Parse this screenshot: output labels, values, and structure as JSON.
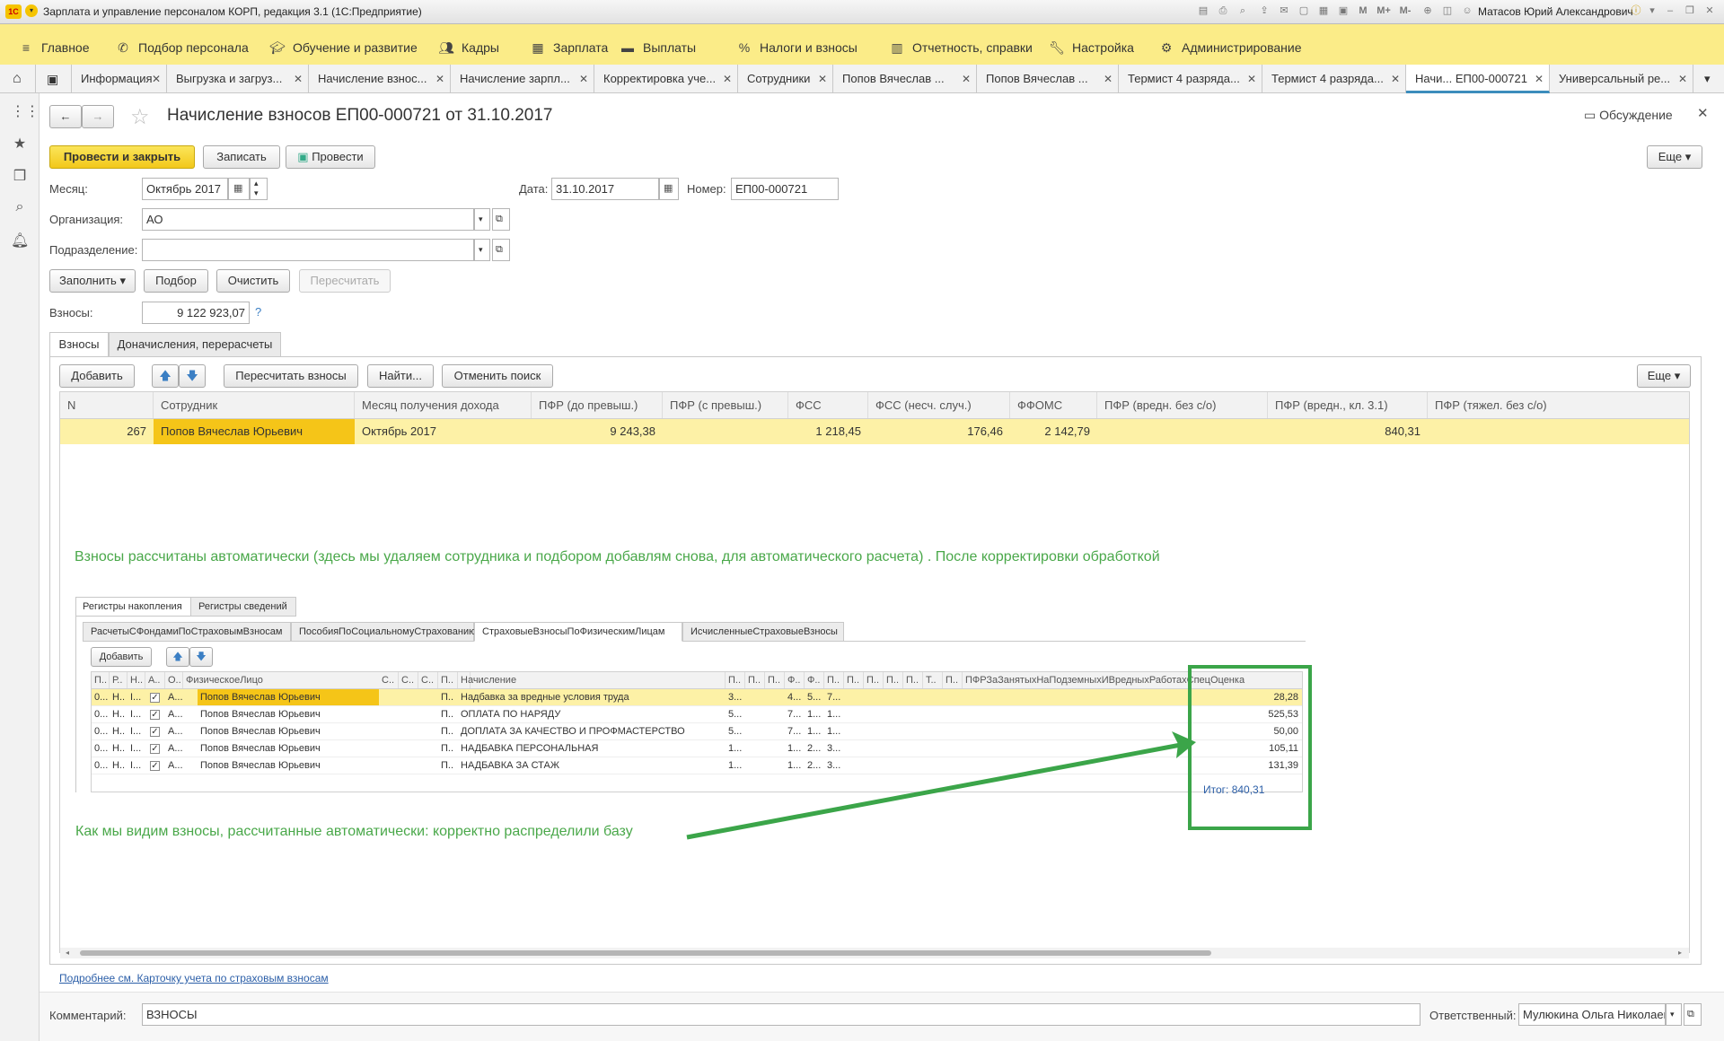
{
  "window": {
    "title": "Зарплата и управление персоналом КОРП, редакция 3.1  (1С:Предприятие)",
    "user": "Матасов Юрий Александрович"
  },
  "menu": [
    "Главное",
    "Подбор персонала",
    "Обучение и развитие",
    "Кадры",
    "Зарплата",
    "Выплаты",
    "Налоги и взносы",
    "Отчетность, справки",
    "Настройка",
    "Администрирование"
  ],
  "tabs": [
    "Информация",
    "Выгрузка и загруз...",
    "Начисление взнос...",
    "Начисление зарпл...",
    "Корректировка уче...",
    "Сотрудники",
    "Попов Вячеслав ...",
    "Попов Вячеслав ...",
    "Термист 4 разряда...",
    "Термист 4 разряда...",
    "Начи... ЕП00-000721",
    "Универсальный ре..."
  ],
  "doc": {
    "title": "Начисление взносов ЕП00-000721 от 31.10.2017",
    "discussion": "Обсуждение",
    "btn_post_close": "Провести и закрыть",
    "btn_save": "Записать",
    "btn_post": "Провести",
    "btn_more": "Еще",
    "month_label": "Месяц:",
    "month_value": "Октябрь 2017",
    "date_label": "Дата:",
    "date_value": "31.10.2017",
    "number_label": "Номер:",
    "number_value": "ЕП00-000721",
    "org_label": "Организация:",
    "org_value": "АО",
    "dept_label": "Подразделение:",
    "dept_value": "",
    "btn_fill": "Заполнить",
    "btn_select": "Подбор",
    "btn_clear": "Очистить",
    "btn_recalc": "Пересчитать",
    "contrib_label": "Взносы:",
    "contrib_value": "9 122 923,07",
    "help": "?",
    "tab1": "Взносы",
    "tab2": "Доначисления, перерасчеты",
    "btn_add": "Добавить",
    "btn_recalc_contrib": "Пересчитать взносы",
    "btn_find": "Найти...",
    "btn_cancel_search": "Отменить поиск",
    "link": "Подробнее см. Карточку учета по страховым взносам",
    "comment_label": "Комментарий:",
    "comment_value": "ВЗНОСЫ",
    "resp_label": "Ответственный:",
    "resp_value": "Мулюкина Ольга Николаевна"
  },
  "grid": {
    "columns": [
      "N",
      "Сотрудник",
      "Месяц получения дохода",
      "ПФР (до превыш.)",
      "ПФР (с превыш.)",
      "ФСС",
      "ФСС (несч. случ.)",
      "ФФОМС",
      "ПФР (вредн. без с/о)",
      "ПФР (вредн., кл. 3.1)",
      "ПФР (тяжел. без с/о)"
    ],
    "row": [
      "267",
      "Попов Вячеслав Юрьевич",
      "Октябрь 2017",
      "9 243,38",
      "",
      "1 218,45",
      "176,46",
      "2 142,79",
      "",
      "840,31",
      ""
    ]
  },
  "annotation1": "Взносы рассчитаны автоматически (здесь мы удаляем сотрудника и подбором добавлям снова, для автоматического расчета)  . После корректировки обработкой",
  "annotation2": "Как мы видим взносы, рассчитанные автоматически: корректно распределили базу",
  "sub": {
    "tabs_top": [
      "Регистры накопления",
      "Регистры сведений"
    ],
    "tabs_second": [
      "РасчетыСФондамиПоСтраховымВзносам",
      "ПособияПоСоциальномуСтрахованию",
      "СтраховыеВзносыПоФизическимЛицам",
      "ИсчисленныеСтраховыеВзносы"
    ],
    "btn_add": "Добавить",
    "headers": [
      "П..",
      "Р..",
      "Н..",
      "А..",
      "О..",
      "ФизическоеЛицо",
      "С..",
      "С..",
      "С..",
      "П..",
      "Начисление",
      "П..",
      "П..",
      "П..",
      "Ф..",
      "Ф..",
      "П..",
      "П..",
      "П..",
      "П..",
      "П..",
      "Т..",
      "П..",
      "ПФРЗаЗанятыхНаПодземныхИВредныхРаботахСпецОценка"
    ],
    "rows": [
      {
        "c1": "0...",
        "c2": "Н..",
        "c3": "I...",
        "c5": "А...",
        "person": "Попов Вячеслав Юрьевич",
        "c9": "П..",
        "c10": "Р...",
        "accrual": "Надбавка за вредные условия труда",
        "n1": "3...",
        "n2": "4...",
        "n3": "5...",
        "n4": "7...",
        "value": "28,28"
      },
      {
        "c1": "0...",
        "c2": "Н..",
        "c3": "I...",
        "c5": "А...",
        "person": "Попов Вячеслав Юрьевич",
        "c9": "П..",
        "c10": "Р...",
        "accrual": "ОПЛАТА ПО НАРЯДУ",
        "n1": "5...",
        "n2": "7...",
        "n3": "1...",
        "n4": "1...",
        "value": "525,53"
      },
      {
        "c1": "0...",
        "c2": "Н..",
        "c3": "I...",
        "c5": "А...",
        "person": "Попов Вячеслав Юрьевич",
        "c9": "П..",
        "c10": "Р...",
        "accrual": "ДОПЛАТА ЗА КАЧЕСТВО И ПРОФМАСТЕРСТВО",
        "n1": "5...",
        "n2": "7...",
        "n3": "1...",
        "n4": "1...",
        "value": "50,00"
      },
      {
        "c1": "0...",
        "c2": "Н..",
        "c3": "I...",
        "c5": "А...",
        "person": "Попов Вячеслав Юрьевич",
        "c9": "П..",
        "c10": "Р...",
        "accrual": "НАДБАВКА ПЕРСОНАЛЬНАЯ",
        "n1": "1...",
        "n2": "1...",
        "n3": "2...",
        "n4": "3...",
        "value": "105,11"
      },
      {
        "c1": "0...",
        "c2": "Н..",
        "c3": "I...",
        "c5": "А...",
        "person": "Попов Вячеслав Юрьевич",
        "c9": "П..",
        "c10": "Р...",
        "accrual": "НАДБАВКА ЗА СТАЖ",
        "n1": "1...",
        "n2": "1...",
        "n3": "2...",
        "n4": "3...",
        "value": "131,39"
      }
    ],
    "total": "Итог: 840,31"
  },
  "colors": {
    "accent": "#f2c81a",
    "menu_bg": "#fbec88",
    "selected_row": "#fdf1a6",
    "green": "#3ba549",
    "link": "#2c5fa8"
  }
}
